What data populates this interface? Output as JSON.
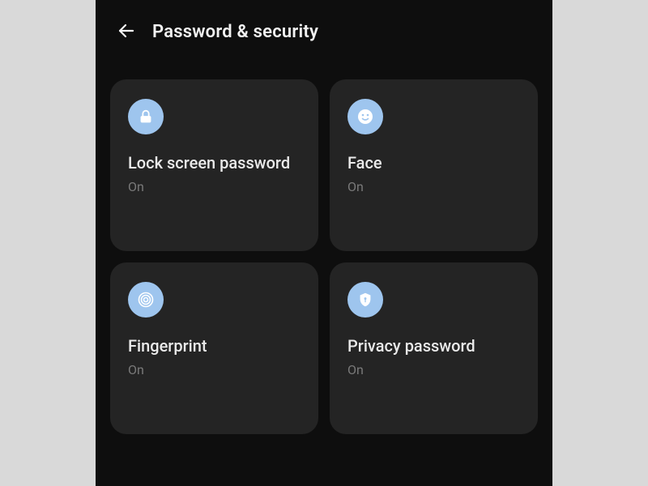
{
  "header": {
    "title": "Password & security"
  },
  "cards": {
    "lockscreen": {
      "title": "Lock screen password",
      "status": "On"
    },
    "face": {
      "title": "Face",
      "status": "On"
    },
    "fingerprint": {
      "title": "Fingerprint",
      "status": "On"
    },
    "privacy": {
      "title": "Privacy password",
      "status": "On"
    }
  },
  "colors": {
    "icon_bg": "#9ec5ee",
    "card_bg": "#242424",
    "page_bg": "#0e0e0e"
  }
}
